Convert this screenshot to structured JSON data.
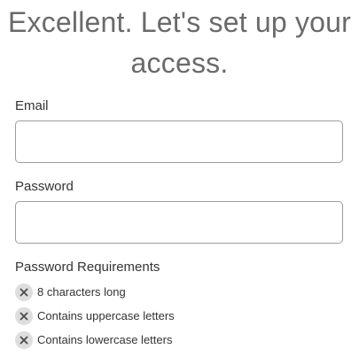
{
  "heading": {
    "line1": "Excellent. Let's set up your",
    "line2": "access."
  },
  "form": {
    "email_label": "Email",
    "email_value": "",
    "password_label": "Password",
    "password_value": ""
  },
  "requirements": {
    "title": "Password Requirements",
    "status_icon": "x-circle-icon",
    "items": [
      {
        "label": "8 characters long",
        "met": false
      },
      {
        "label": "Contains uppercase letters",
        "met": false
      },
      {
        "label": "Contains lowercase letters",
        "met": false
      }
    ]
  },
  "colors": {
    "heading_text": "#6a6a6a",
    "input_border": "#9d9d9d",
    "icon_bg": "#dedede",
    "icon_x": "#4a4a4a"
  }
}
